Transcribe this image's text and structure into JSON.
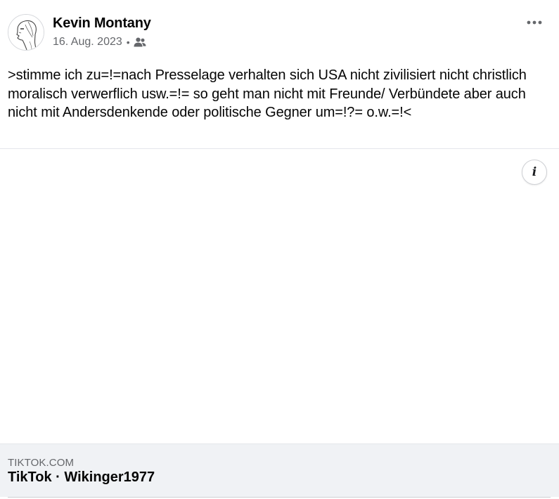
{
  "post": {
    "author": "Kevin Montany",
    "date": "16. Aug. 2023",
    "separator": "•",
    "audience_icon": "friends-icon",
    "more_icon": "more-horizontal-icon",
    "text": ">stimme ich zu=!=nach Presselage verhalten sich USA nicht zivilisiert nicht christlich moralisch verwerflich usw.=!= so geht man nicht mit Freunde/ Verbündete aber auch nicht mit Andersdenkende oder politische Gegner um=!?= o.w.=!<"
  },
  "media": {
    "info_icon": "info-icon",
    "info_glyph": "i"
  },
  "link_preview": {
    "domain": "TIKTOK.COM",
    "title": "TikTok · Wikinger1977"
  },
  "colors": {
    "text_primary": "#050505",
    "text_secondary": "#65676b",
    "card_background": "#f0f2f5",
    "divider": "#e4e6eb"
  }
}
